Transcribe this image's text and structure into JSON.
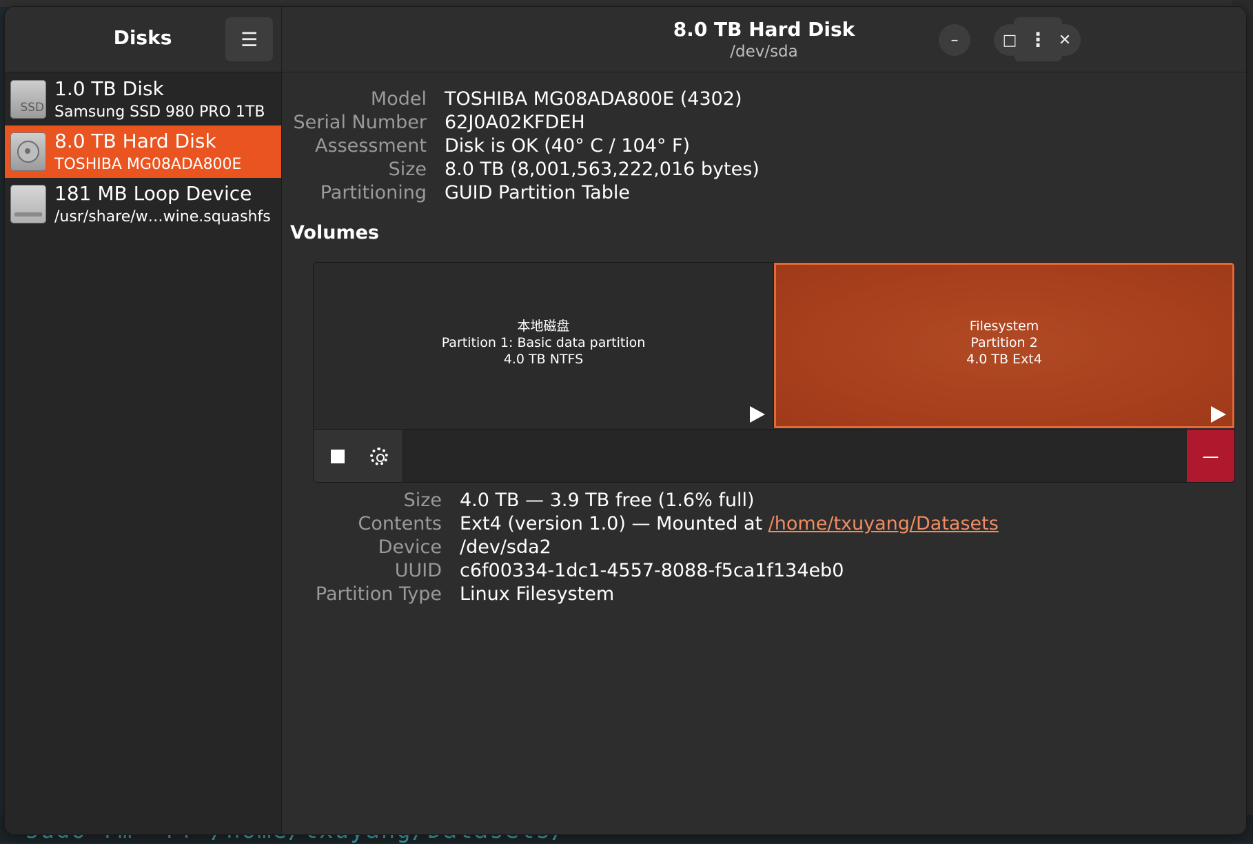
{
  "sidebar": {
    "title": "Disks",
    "menu_icon": "hamburger-menu-icon",
    "disks": [
      {
        "name": "1.0 TB Disk",
        "sub": "Samsung SSD 980 PRO 1TB",
        "icon": "ssd-icon",
        "icon_text": "SSD",
        "selected": false
      },
      {
        "name": "8.0 TB Hard Disk",
        "sub": "TOSHIBA MG08ADA800E",
        "icon": "hard-disk-icon",
        "selected": true
      },
      {
        "name": "181 MB Loop Device",
        "sub": "/usr/share/w…wine.squashfs",
        "icon": "loop-device-icon",
        "selected": false
      }
    ]
  },
  "header": {
    "title": "8.0 TB Hard Disk",
    "subtitle": "/dev/sda",
    "menu_glyph": "⋮",
    "minimize_glyph": "–",
    "maximize_glyph": "□",
    "close_glyph": "✕"
  },
  "disk_info": [
    {
      "label": "Model",
      "value": "TOSHIBA MG08ADA800E (4302)"
    },
    {
      "label": "Serial Number",
      "value": "62J0A02KFDEH"
    },
    {
      "label": "Assessment",
      "value": "Disk is OK (40° C / 104° F)"
    },
    {
      "label": "Size",
      "value": "8.0 TB (8,001,563,222,016 bytes)"
    },
    {
      "label": "Partitioning",
      "value": "GUID Partition Table"
    }
  ],
  "volumes": {
    "heading": "Volumes",
    "partitions": [
      {
        "line1": "本地磁盘",
        "line2": "Partition 1: Basic data partition",
        "line3": "4.0 TB NTFS",
        "selected": false
      },
      {
        "line1": "Filesystem",
        "line2": "Partition 2",
        "line3": "4.0 TB Ext4",
        "selected": true
      }
    ],
    "toolbar": {
      "stop_icon": "stop-icon",
      "settings_icon": "gear-icon",
      "delete_icon": "minus-icon",
      "delete_glyph": "—"
    }
  },
  "volume_details": {
    "size_label": "Size",
    "size_value": "4.0 TB — 3.9 TB free (1.6% full)",
    "contents_label": "Contents",
    "contents_prefix": "Ext4 (version 1.0) — Mounted at ",
    "contents_link": "/home/txuyang/Datasets",
    "device_label": "Device",
    "device_value": "/dev/sda2",
    "uuid_label": "UUID",
    "uuid_value": "c6f00334-1dc1-4557-8088-f5ca1f134eb0",
    "parttype_label": "Partition Type",
    "parttype_value": "Linux Filesystem"
  },
  "background": {
    "terminal_text": "sudo rm -rf /home/txuyang/Datasets/"
  },
  "colors": {
    "accent": "#e95420",
    "partition_selected": "#a83f1d",
    "delete": "#b0182d",
    "link": "#f08c62"
  }
}
